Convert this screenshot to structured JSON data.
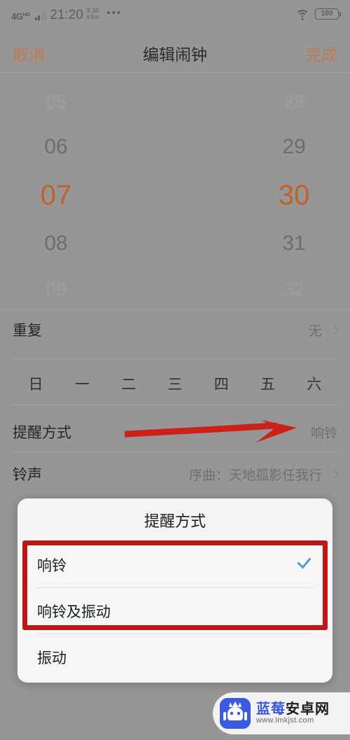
{
  "status_bar": {
    "network": "4G",
    "network_suffix": "HD",
    "time": "21:20",
    "speed_value": "9.30",
    "speed_unit": "KB/s",
    "overflow": "•••",
    "wifi_icon": "wifi-icon",
    "battery_level": "100"
  },
  "nav": {
    "cancel": "取消",
    "title": "编辑闹钟",
    "done": "完成",
    "accent_color": "#c07a50"
  },
  "time_picker": {
    "hours": [
      "05",
      "06",
      "07",
      "08",
      "09"
    ],
    "minutes": [
      "28",
      "29",
      "30",
      "31",
      "32"
    ],
    "selected_hour": "07",
    "selected_minute": "30",
    "selected_color": "#c0622a"
  },
  "rows": {
    "repeat": {
      "label": "重复",
      "value": "无"
    },
    "reminder": {
      "label": "提醒方式",
      "value": "响铃"
    },
    "ringtone": {
      "label": "铃声",
      "value": "序曲：天地孤影任我行"
    }
  },
  "weekdays": [
    "日",
    "一",
    "二",
    "三",
    "四",
    "五",
    "六"
  ],
  "annotation": {
    "arrow_color": "#cc2118",
    "box_color": "#bf1717"
  },
  "dialog": {
    "title": "提醒方式",
    "options": [
      {
        "label": "响铃",
        "checked": true
      },
      {
        "label": "响铃及振动",
        "checked": false
      },
      {
        "label": "振动",
        "checked": false
      }
    ],
    "check_color": "#4a9fd6"
  },
  "watermark": {
    "name_blue": "蓝莓",
    "name_dark": "安卓网",
    "url": "www.lmkjst.com",
    "logo_color": "#3b5ae0"
  }
}
